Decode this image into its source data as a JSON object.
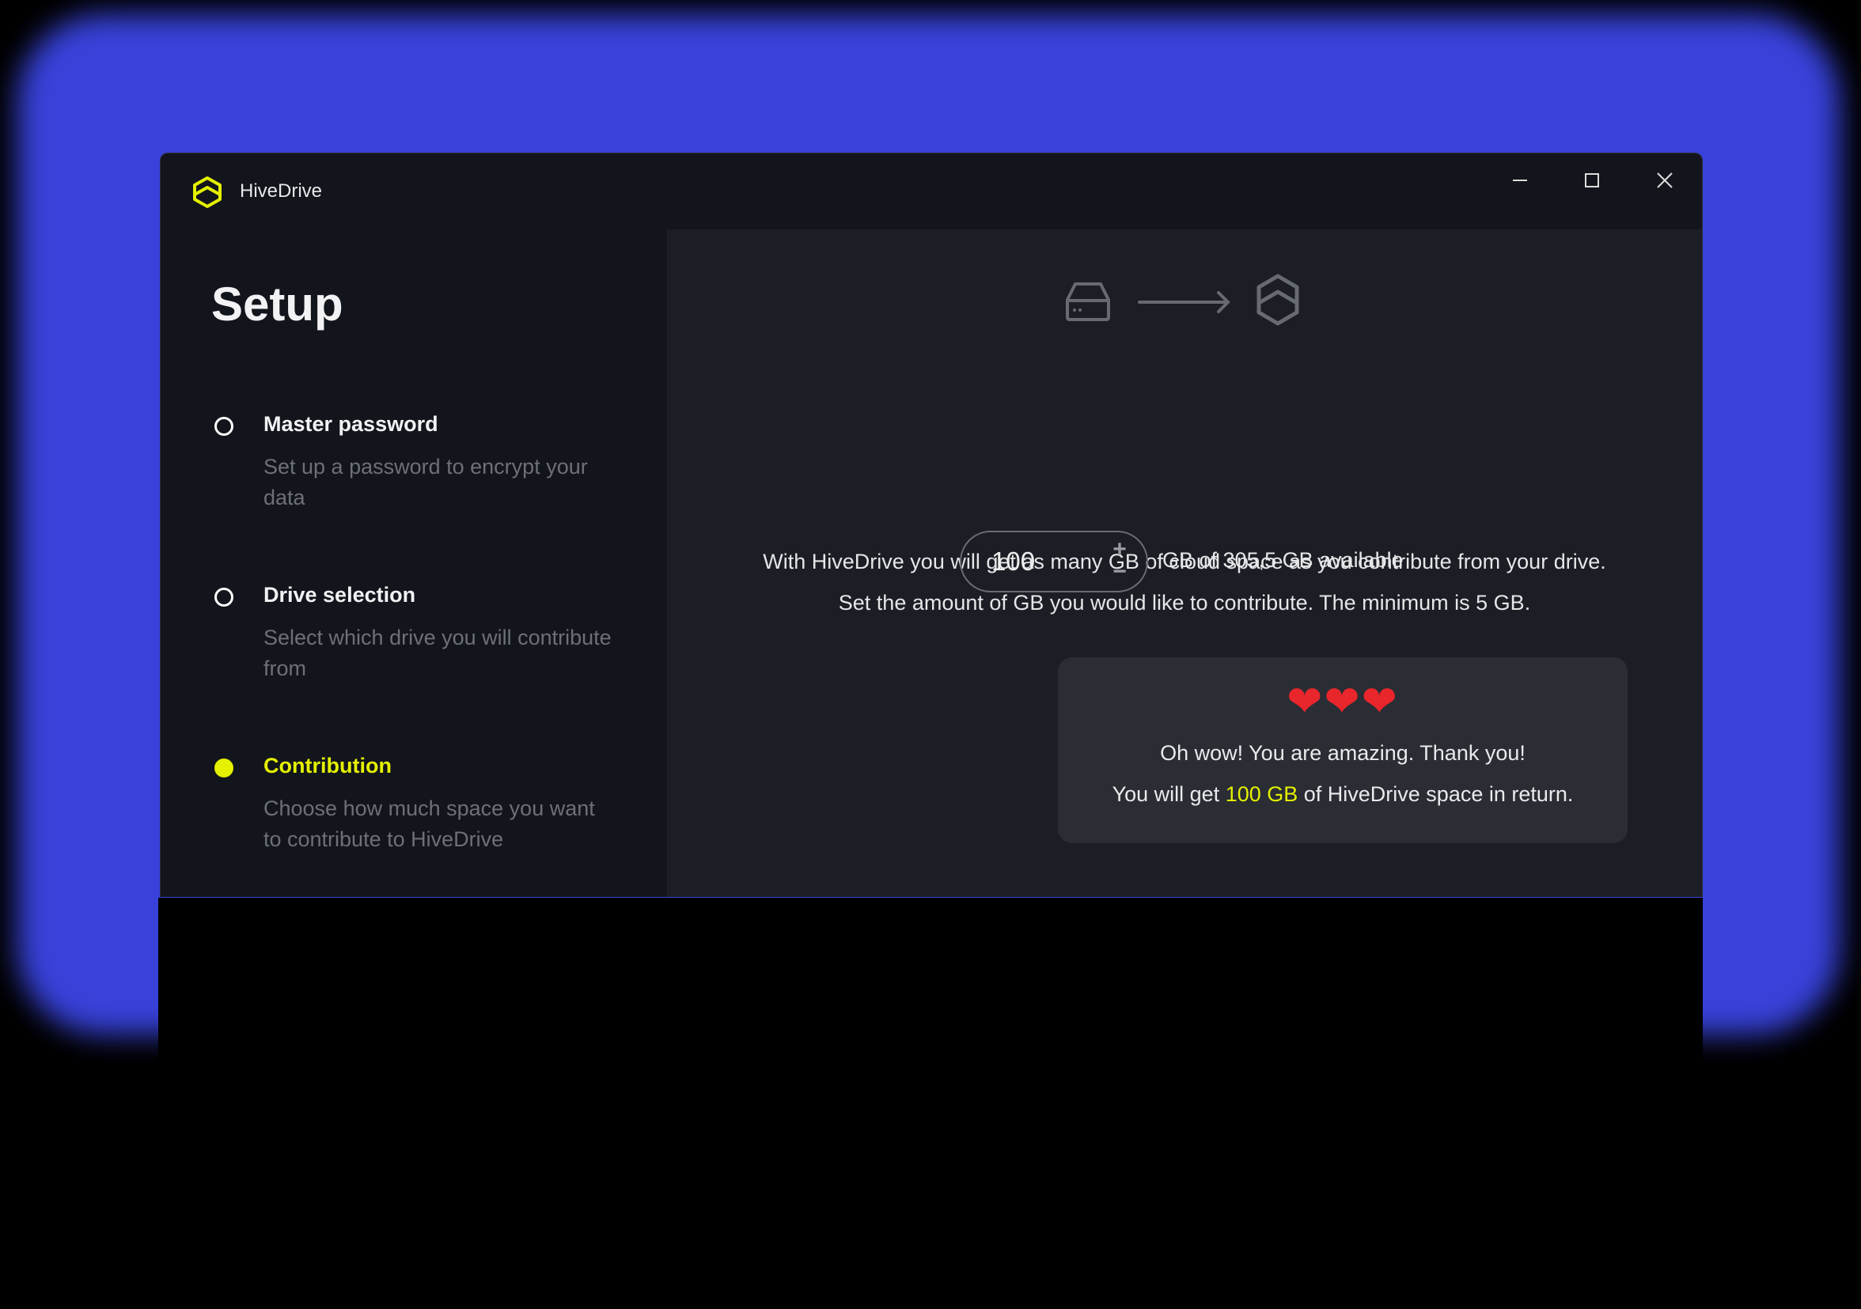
{
  "window": {
    "title": "HiveDrive",
    "controls": [
      "minimize-icon",
      "maximize-icon",
      "close-icon"
    ]
  },
  "sidebar": {
    "heading": "Setup",
    "steps": [
      {
        "title": "Master password",
        "description": "Set up a password to encrypt your data",
        "state": "pending"
      },
      {
        "title": "Drive selection",
        "description": "Select which drive you will contribute from",
        "state": "pending"
      },
      {
        "title": "Contribution",
        "description": "Choose how much space you want to contribute to HiveDrive",
        "state": "active"
      }
    ]
  },
  "main": {
    "intro_line1": "With HiveDrive you will get as many GB of cloud space as you contribute from your drive.",
    "intro_line2": "Set the amount of GB you would like to contribute. The minimum is 5 GB.",
    "amount": "100",
    "increment": "+",
    "decrement": "−",
    "available_label": "GB of 305,5 GB available",
    "card": {
      "hearts": "❤❤❤",
      "line1": "Oh wow! You are amazing. Thank you!",
      "line2_prefix": "You will get ",
      "line2_highlight": "100 GB",
      "line2_suffix": " of HiveDrive space in return."
    }
  },
  "colors": {
    "accent": "#e4f100",
    "glow": "#3b46e6",
    "sidebar_bg": "#13151c",
    "main_bg": "#1b1e25",
    "card_bg": "#2a2d34"
  }
}
